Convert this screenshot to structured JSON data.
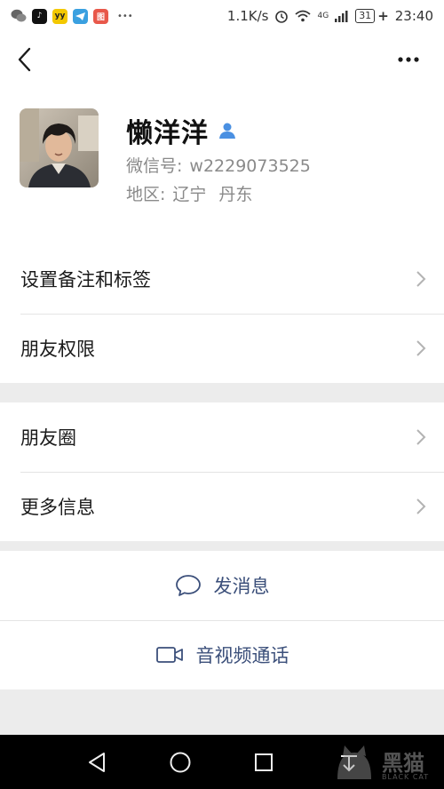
{
  "status_bar": {
    "net_speed": "1.1K/s",
    "network_type": "4G",
    "battery": "31",
    "time": "23:40",
    "app_icons": [
      "wechat-icon",
      "tiktok-icon",
      "yy-icon",
      "telegram-icon",
      "red-app-icon"
    ],
    "more_dots": "•••"
  },
  "profile": {
    "name": "懒洋洋",
    "wechat_id_label": "微信号:",
    "wechat_id": "w2229073525",
    "region_label": "地区:",
    "province": "辽宁",
    "city": "丹东"
  },
  "settings_group_1": [
    {
      "label": "设置备注和标签"
    },
    {
      "label": "朋友权限"
    }
  ],
  "settings_group_2": [
    {
      "label": "朋友圈"
    },
    {
      "label": "更多信息"
    }
  ],
  "actions": {
    "message": "发消息",
    "video_call": "音视频通话"
  },
  "watermark": {
    "text": "黑猫",
    "sub": "BLACK CAT"
  },
  "colors": {
    "accent_link": "#3b4f7a",
    "verified_blue": "#4a90e2",
    "background": "#ececec"
  }
}
